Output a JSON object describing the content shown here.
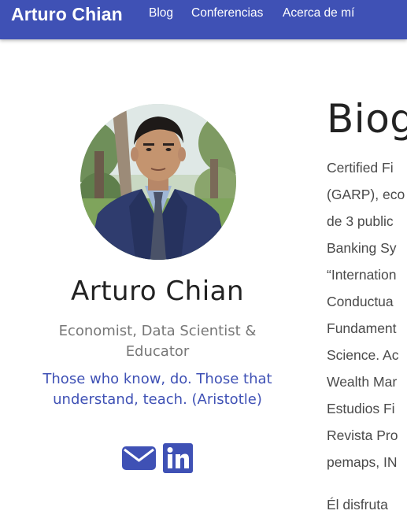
{
  "navbar": {
    "brand": "Arturo Chian",
    "links": [
      "Blog",
      "Conferencias",
      "Acerca de mí"
    ]
  },
  "profile": {
    "name": "Arturo Chian",
    "role": "Economist, Data Scientist & Educator",
    "quote": "Those who know, do. Those that understand, teach. (Aristotle)",
    "social_icons": [
      "envelope-icon",
      "linkedin-icon"
    ]
  },
  "bio": {
    "title": "Biog",
    "lines": [
      "Certified Fi",
      "(GARP), eco",
      "de 3 public",
      "Banking Sy",
      "“Internation",
      "Conductua",
      "Fundament",
      "Science. Ac",
      "Wealth Mar",
      "Estudios Fi",
      "Revista Pro",
      "pemaps, IN"
    ],
    "second_paragraph": "Él disfruta"
  },
  "colors": {
    "brand": "#3f51b5",
    "text": "#222222",
    "muted": "#777777"
  }
}
